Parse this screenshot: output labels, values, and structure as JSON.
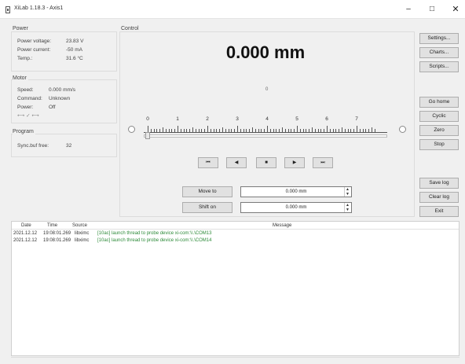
{
  "window": {
    "title": "XiLab 1.18.3 - Axis1",
    "minimize": "–",
    "maximize": "□",
    "close": "✕"
  },
  "power": {
    "label": "Power",
    "rows": [
      {
        "key": "Power voltage:",
        "value": "23.83 V"
      },
      {
        "key": "Power current:",
        "value": "-50 mA"
      },
      {
        "key": "Temp.:",
        "value": "31.6 °C"
      }
    ]
  },
  "motor": {
    "label": "Motor",
    "rows": [
      {
        "key": "Speed:",
        "value": "0.000 mm/s"
      },
      {
        "key": "Command:",
        "value": "Unknown"
      },
      {
        "key": "Power:",
        "value": "Off"
      }
    ],
    "indicator": "⟷ ✓ ⟷"
  },
  "program": {
    "label": "Program",
    "rows": [
      {
        "key": "Sync.buf free:",
        "value": "32"
      }
    ]
  },
  "control": {
    "label": "Control",
    "position": "0.000 mm",
    "zero_mark": "0",
    "scale": [
      "0",
      "1",
      "2",
      "3",
      "4",
      "5",
      "6",
      "7"
    ],
    "media_buttons": [
      "⏮",
      "◀",
      "■",
      "▶",
      "⏭"
    ],
    "move_to": {
      "label": "Move to",
      "value": "0.000 mm"
    },
    "shift_on": {
      "label": "Shift on",
      "value": "0.000 mm"
    }
  },
  "side_buttons": {
    "settings": "Settings...",
    "charts": "Charts...",
    "scripts": "Scripts...",
    "go_home": "Go home",
    "cyclic": "Cyclic",
    "zero": "Zero",
    "stop": "Stop",
    "save_log": "Save log",
    "clear_log": "Clear log",
    "exit": "Exit"
  },
  "log": {
    "columns": {
      "date": "Date",
      "time": "Time",
      "source": "Source",
      "message": "Message"
    },
    "rows": [
      {
        "date": "2021.12.12",
        "time": "19:08:01.269",
        "source": "libximc",
        "message": "[10ac] launch thread to probe device xi-com:\\\\.\\COM13"
      },
      {
        "date": "2021.12.12",
        "time": "19:08:01.269",
        "source": "libximc",
        "message": "[10ac] launch thread to probe device xi-com:\\\\.\\COM14"
      }
    ]
  }
}
